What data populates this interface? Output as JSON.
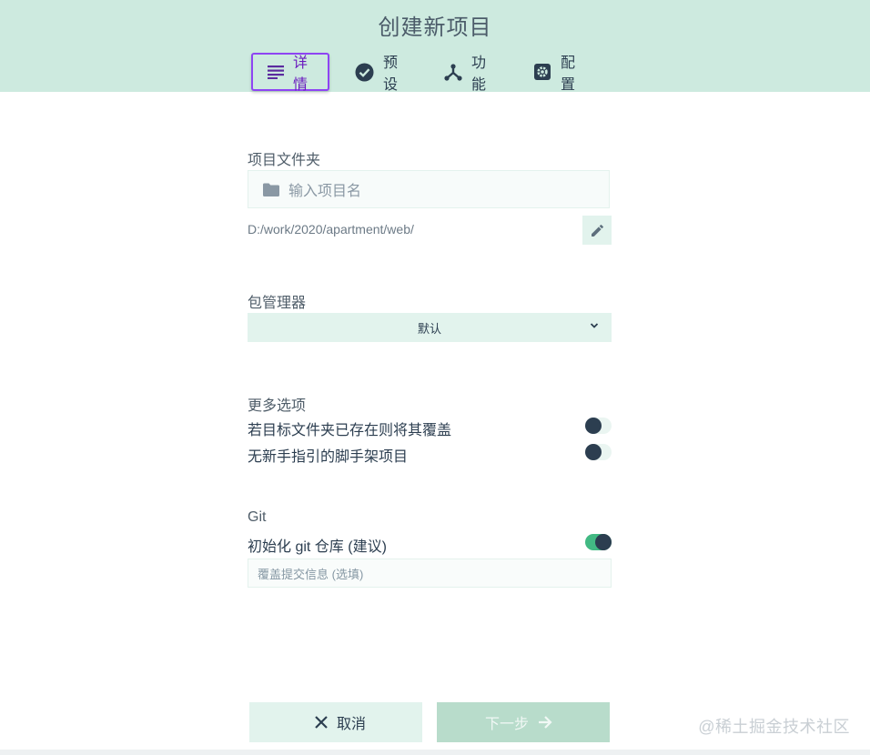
{
  "header": {
    "title": "创建新项目",
    "tabs": [
      {
        "label": "详情",
        "icon": "list-icon",
        "active": true
      },
      {
        "label": "预设",
        "icon": "check-circle-icon",
        "active": false
      },
      {
        "label": "功能",
        "icon": "fork-icon",
        "active": false
      },
      {
        "label": "配置",
        "icon": "settings-icon",
        "active": false
      }
    ]
  },
  "folder": {
    "label": "项目文件夹",
    "placeholder": "输入项目名",
    "path": "D:/work/2020/apartment/web/"
  },
  "package_manager": {
    "label": "包管理器",
    "selected": "默认"
  },
  "more_options": {
    "label": "更多选项",
    "items": [
      {
        "label": "若目标文件夹已存在则将其覆盖",
        "on": false
      },
      {
        "label": "无新手指引的脚手架项目",
        "on": false
      }
    ]
  },
  "git": {
    "label": "Git",
    "init_label": "初始化 git 仓库 (建议)",
    "init_on": true,
    "commit_placeholder": "覆盖提交信息 (选填)"
  },
  "footer": {
    "cancel_label": "取消",
    "next_label": "下一步"
  },
  "watermark": "@稀土掘金技术社区",
  "colors": {
    "header_bg": "#cdeadf",
    "accent_green": "#42b983",
    "active_tab_border": "#8e44f3",
    "dark": "#2c3e50"
  }
}
